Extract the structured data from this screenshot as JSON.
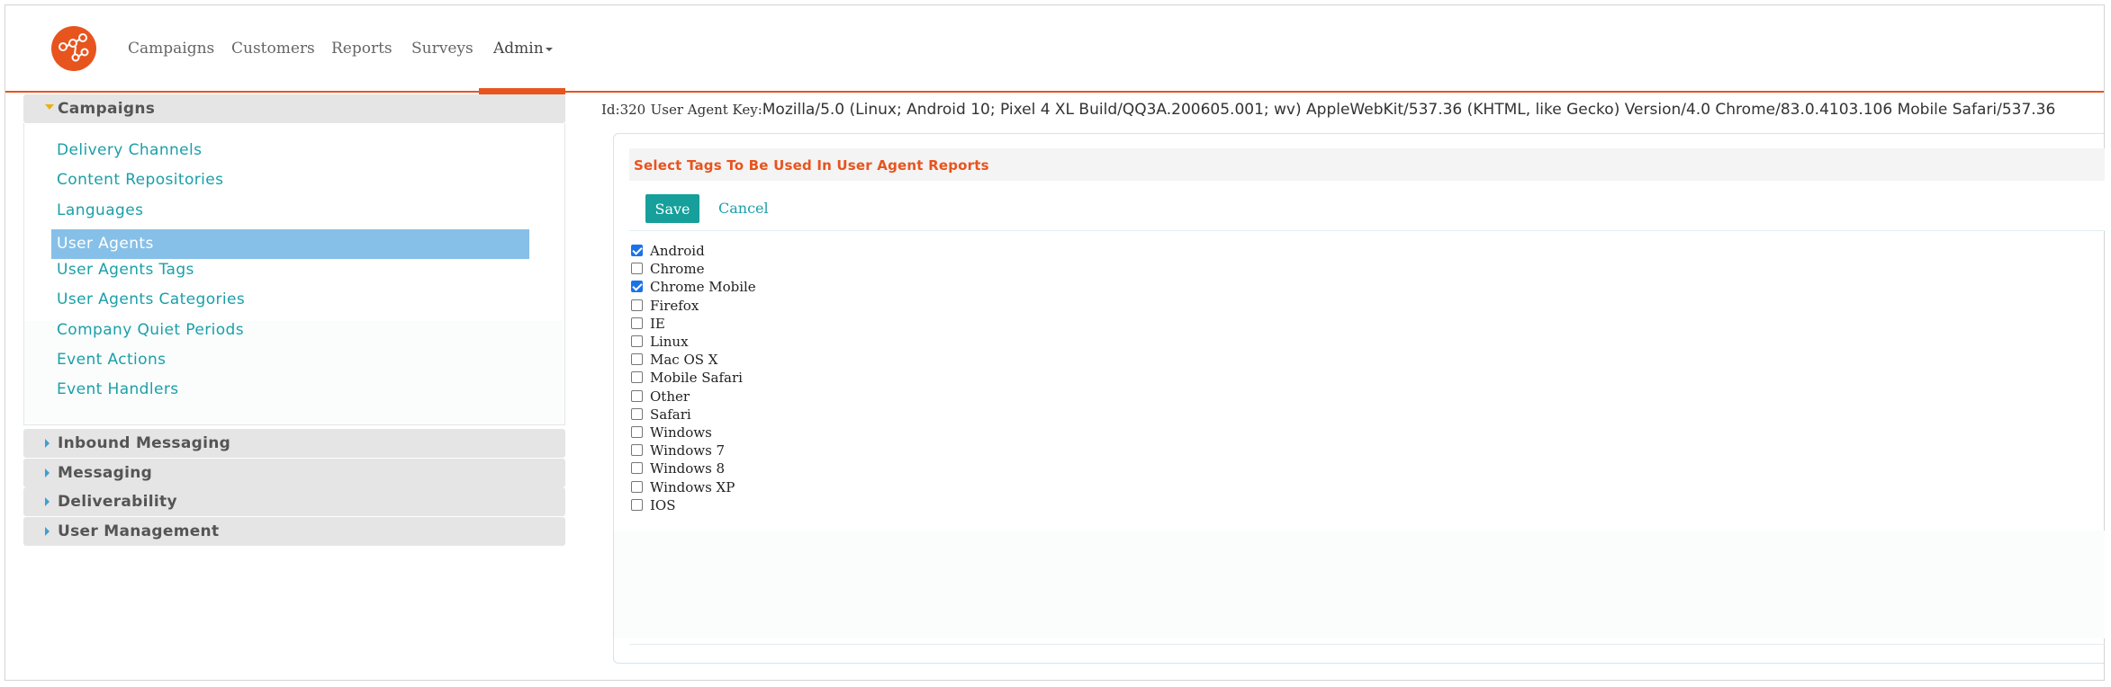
{
  "nav": {
    "items": [
      {
        "label": "Campaigns"
      },
      {
        "label": "Customers"
      },
      {
        "label": "Reports"
      },
      {
        "label": "Surveys"
      },
      {
        "label": "Admin"
      }
    ],
    "accent": "#e8541e"
  },
  "sidebar": {
    "campaigns_header": "Campaigns",
    "items": [
      {
        "label": "Delivery Channels"
      },
      {
        "label": "Content Repositories"
      },
      {
        "label": "Languages"
      },
      {
        "label": "User Agents"
      },
      {
        "label": "User Agents Tags"
      },
      {
        "label": "User Agents Categories"
      },
      {
        "label": "Company Quiet Periods"
      },
      {
        "label": "Event Actions"
      },
      {
        "label": "Event Handlers"
      }
    ],
    "active_item": "User Agents",
    "sections": [
      {
        "label": "Inbound Messaging"
      },
      {
        "label": "Messaging"
      },
      {
        "label": "Deliverability"
      },
      {
        "label": "User Management"
      }
    ],
    "link_color": "#1b9fa8",
    "active_color": "#86c0e8"
  },
  "main": {
    "id_text": "Id:320",
    "ua_key_label": "User Agent Key:",
    "ua_key_value": "Mozilla/5.0 (Linux; Android 10; Pixel 4 XL Build/QQ3A.200605.001; wv) AppleWebKit/537.36 (KHTML, like Gecko) Version/4.0 Chrome/83.0.4103.106 Mobile Safari/537.36",
    "panel_title": "Select Tags To Be Used In User Agent Reports",
    "save_label": "Save",
    "cancel_label": "Cancel",
    "tags": [
      {
        "label": "Android",
        "checked": true
      },
      {
        "label": "Chrome",
        "checked": false
      },
      {
        "label": "Chrome Mobile",
        "checked": true
      },
      {
        "label": "Firefox",
        "checked": false
      },
      {
        "label": "IE",
        "checked": false
      },
      {
        "label": "Linux",
        "checked": false
      },
      {
        "label": "Mac OS X",
        "checked": false
      },
      {
        "label": "Mobile Safari",
        "checked": false
      },
      {
        "label": "Other",
        "checked": false
      },
      {
        "label": "Safari",
        "checked": false
      },
      {
        "label": "Windows",
        "checked": false
      },
      {
        "label": "Windows 7",
        "checked": false
      },
      {
        "label": "Windows 8",
        "checked": false
      },
      {
        "label": "Windows XP",
        "checked": false
      },
      {
        "label": "IOS",
        "checked": false
      }
    ],
    "save_color": "#169f9b"
  }
}
